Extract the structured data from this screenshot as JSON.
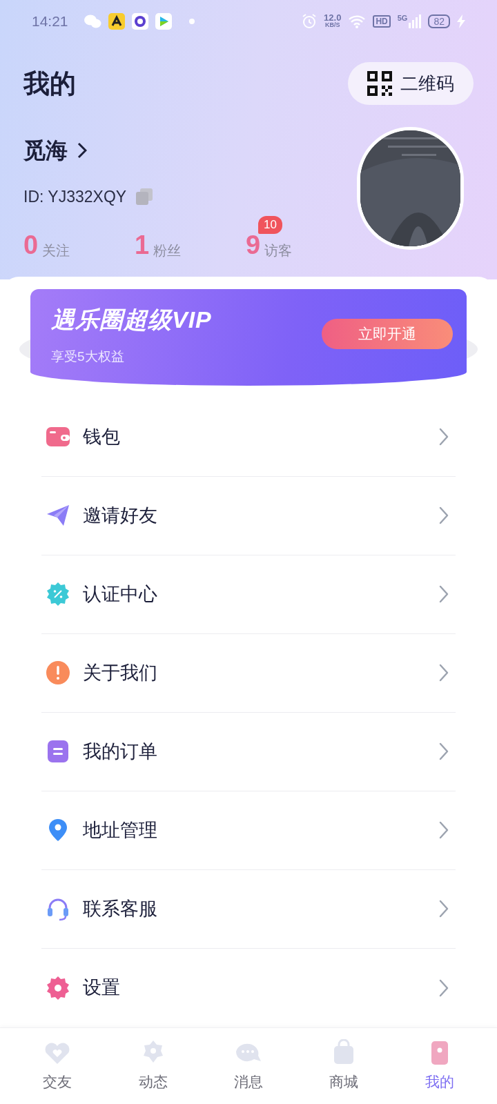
{
  "status_bar": {
    "time": "14:21",
    "speed_value": "12.0",
    "speed_unit": "KB/S",
    "hd": "HD",
    "network": "5G",
    "battery": "82"
  },
  "header": {
    "title": "我的",
    "qr_button": "二维码"
  },
  "profile": {
    "name": "觅海",
    "id": "ID: YJ332XQY"
  },
  "stats": [
    {
      "value": "0",
      "label": "关注"
    },
    {
      "value": "1",
      "label": "粉丝"
    },
    {
      "value": "9",
      "label": "访客",
      "badge": "10"
    }
  ],
  "vip_banner": {
    "title": "遇乐圈超级VIP",
    "subtitle": "享受5大权益",
    "button": "立即开通"
  },
  "menu": [
    {
      "label": "钱包"
    },
    {
      "label": "邀请好友"
    },
    {
      "label": "认证中心"
    },
    {
      "label": "关于我们"
    },
    {
      "label": "我的订单"
    },
    {
      "label": "地址管理"
    },
    {
      "label": "联系客服"
    },
    {
      "label": "设置"
    }
  ],
  "tab_bar": [
    {
      "label": "交友",
      "selected": false
    },
    {
      "label": "动态",
      "selected": false
    },
    {
      "label": "消息",
      "selected": false
    },
    {
      "label": "商城",
      "selected": false
    },
    {
      "label": "我的",
      "selected": true
    }
  ]
}
